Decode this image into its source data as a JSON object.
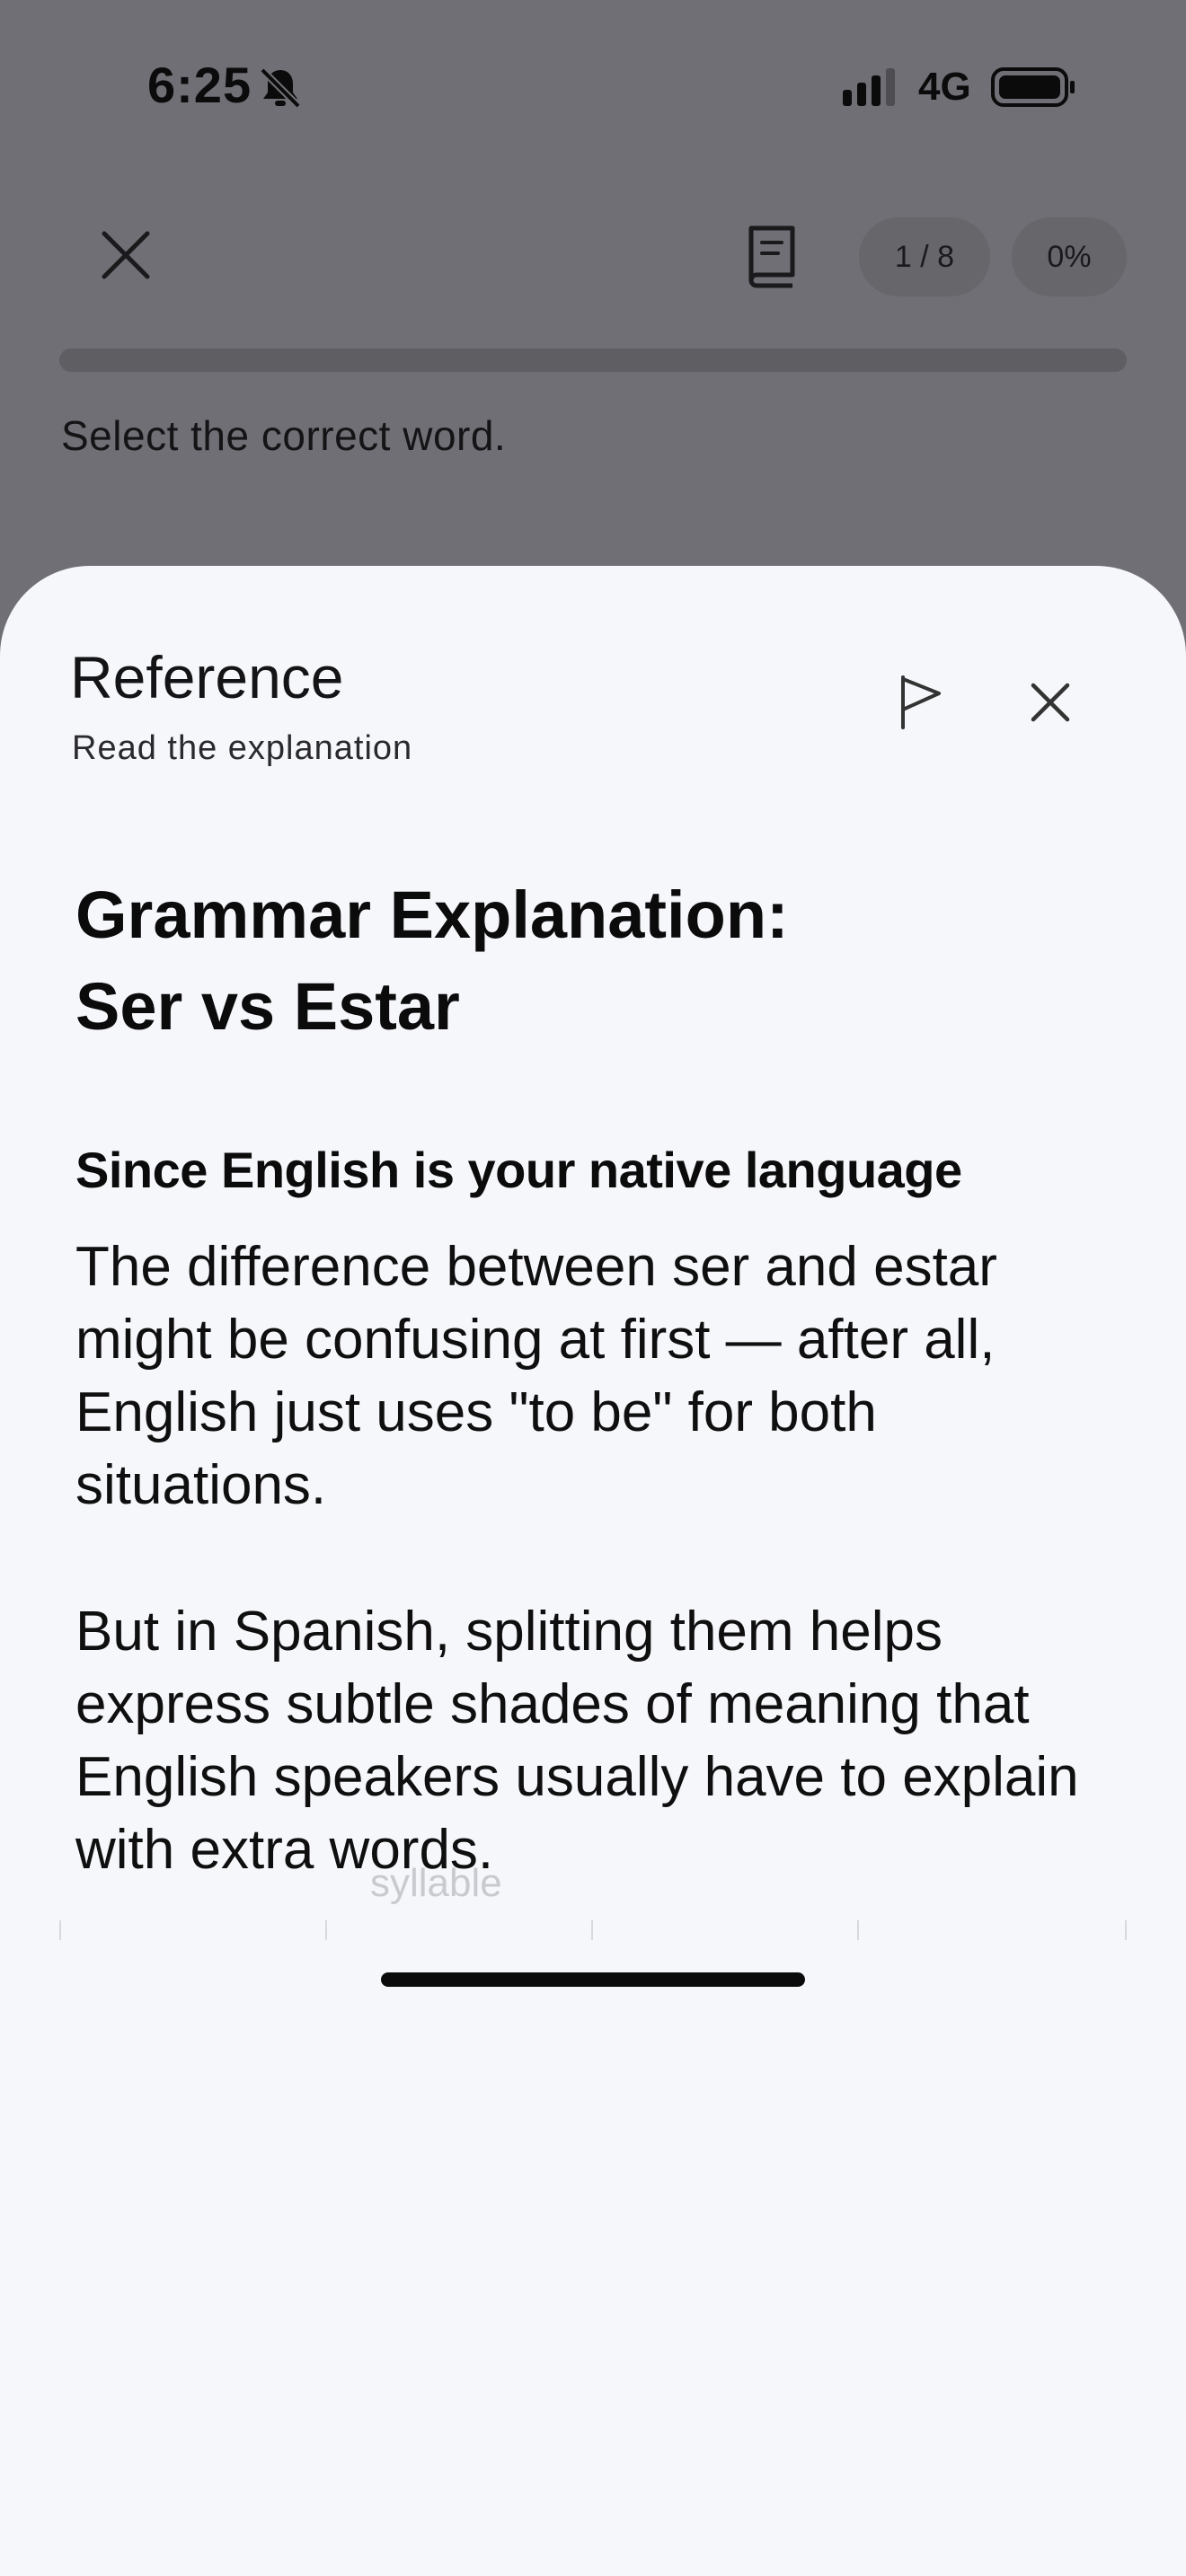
{
  "status_bar": {
    "time": "6:25",
    "network": "4G"
  },
  "toolbar": {
    "progress_label": "1 / 8",
    "percent_label": "0%"
  },
  "exercise": {
    "instruction": "Select the correct word."
  },
  "sheet": {
    "title": "Reference",
    "subtitle": "Read the explanation",
    "heading_line1": "Grammar Explanation:",
    "heading_line2": "Ser vs Estar",
    "subheading": "Since English is your native language",
    "paragraph1": "The difference between ser and estar might be confusing at first — after all, English just uses \"to be\" for both situations.",
    "paragraph2": "But in Spanish, splitting them helps express subtle shades of meaning that English speakers usually have to explain with extra words.",
    "faded_label": "syllable"
  },
  "icons": {
    "bell": "bell-slash-icon",
    "signal": "signal-icon",
    "battery": "battery-icon",
    "close": "close-icon",
    "book": "book-icon",
    "flag": "flag-icon"
  },
  "colors": {
    "overlay": "#6f6f75",
    "sheet_bg": "#f6f7fb",
    "text": "#0b0b0c"
  }
}
